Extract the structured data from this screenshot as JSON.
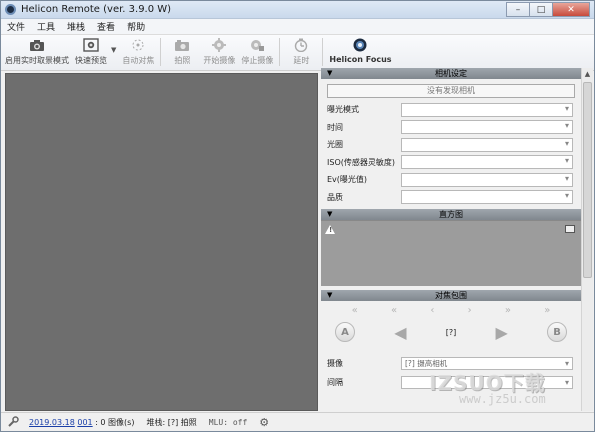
{
  "window": {
    "title": "Helicon Remote (ver. 3.9.0 W)",
    "buttons": [
      "–",
      "□",
      "✕"
    ]
  },
  "menu": [
    "文件",
    "工具",
    "堆栈",
    "查看",
    "帮助"
  ],
  "toolbar": {
    "live_view": "启用实时取景模式",
    "quick_preview": "快速预览",
    "autofocus": "自动对焦",
    "shoot": "拍照",
    "start_shooting": "开始摄像",
    "stop_shooting": "停止摄像",
    "delay": "延时",
    "helicon_focus": "Helicon Focus"
  },
  "camera_settings": {
    "header": "相机设定",
    "no_camera": "没有发现相机",
    "fields": [
      "曝光模式",
      "时间",
      "光圈",
      "ISO(传感器灵敏度)",
      "Ev(曝光值)",
      "品质"
    ]
  },
  "histogram": {
    "header": "直方图"
  },
  "focus_bracketing": {
    "header": "对焦包围",
    "current": "[?]",
    "button_a": "A",
    "button_b": "B",
    "fields": [
      {
        "label": "摄像",
        "value": "[?]  摄高相机"
      },
      {
        "label": "间隔",
        "value": ""
      }
    ]
  },
  "status": {
    "date": "2019.03.18",
    "session": "001",
    "images": ": 0 图像(s)",
    "stack": "堆栈: [?] 拍照",
    "mlu": "MLU: off"
  },
  "watermark": {
    "line1": "IZSUO下载",
    "line2": "www.jz5u.com"
  },
  "colors": {
    "live_bg": "#6e6e6e",
    "section_header": "#8a9097",
    "histogram_bg": "#9c9c9c"
  }
}
